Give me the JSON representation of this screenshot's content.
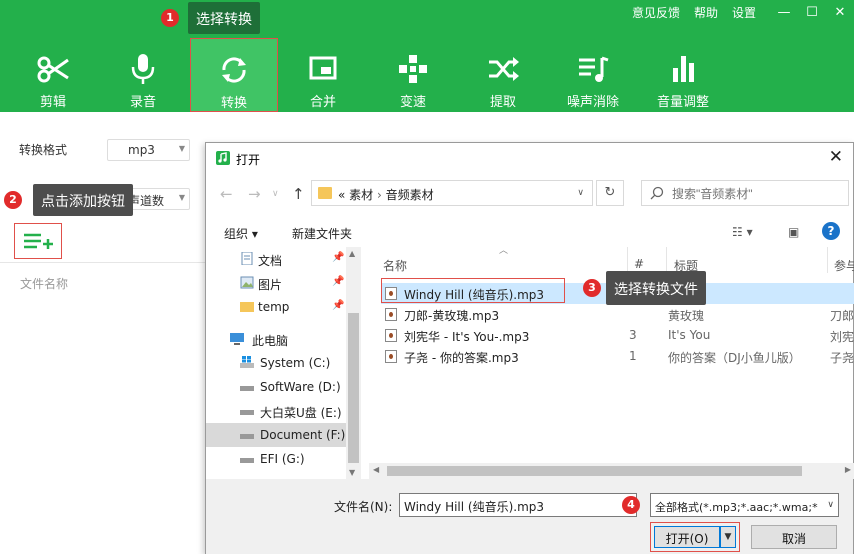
{
  "header": {
    "links": [
      "意见反馈",
      "帮助",
      "设置"
    ],
    "window_controls": [
      "—",
      "☐",
      "✕"
    ],
    "tools": [
      {
        "label": "剪辑",
        "icon": "scissors-icon"
      },
      {
        "label": "录音",
        "icon": "microphone-icon"
      },
      {
        "label": "转换",
        "icon": "sync-icon"
      },
      {
        "label": "合并",
        "icon": "merge-icon"
      },
      {
        "label": "变速",
        "icon": "speed-icon"
      },
      {
        "label": "提取",
        "icon": "shuffle-icon"
      },
      {
        "label": "噪声消除",
        "icon": "noise-icon"
      },
      {
        "label": "音量调整",
        "icon": "volume-bars-icon"
      }
    ],
    "active_tool": "转换"
  },
  "left_panel": {
    "format_label": "转换格式",
    "format_value": "mp3",
    "channel_value": "声道数",
    "file_name_column": "文件名称"
  },
  "dialog": {
    "title": "打开",
    "address": {
      "prefix": "«",
      "path": [
        "素材",
        "音频素材"
      ]
    },
    "search_placeholder": "搜索\"音频素材\"",
    "toolbar": {
      "organize": "组织 ▾",
      "new_folder": "新建文件夹"
    },
    "tree": [
      {
        "label": "文档",
        "icon": "document-icon",
        "pinned": true
      },
      {
        "label": "图片",
        "icon": "picture-icon",
        "pinned": true
      },
      {
        "label": "temp",
        "icon": "folder-icon",
        "pinned": true
      },
      {
        "label": "此电脑",
        "icon": "computer-icon",
        "pinned": false
      },
      {
        "label": "System (C:)",
        "icon": "windows-drive-icon",
        "pinned": false
      },
      {
        "label": "SoftWare (D:)",
        "icon": "drive-icon",
        "pinned": false
      },
      {
        "label": "大白菜U盘 (E:)",
        "icon": "drive-icon",
        "pinned": false
      },
      {
        "label": "Document (F:)",
        "icon": "drive-icon",
        "pinned": false
      },
      {
        "label": "EFI (G:)",
        "icon": "drive-icon",
        "pinned": false
      }
    ],
    "tree_selected": "Document (F:)",
    "columns": [
      "名称",
      "#",
      "标题",
      "参与"
    ],
    "files": [
      {
        "name": "Windy Hill (纯音乐).mp3",
        "num": "",
        "title": "",
        "artist": ""
      },
      {
        "name": "刀郎-黄玫瑰.mp3",
        "num": "",
        "title": "黄玫瑰",
        "artist": "刀郎"
      },
      {
        "name": "刘宪华 - It's You-.mp3",
        "num": "3",
        "title": "It's You",
        "artist": "刘宪"
      },
      {
        "name": "子尧 - 你的答案.mp3",
        "num": "1",
        "title": "你的答案（DJ小鱼儿版）",
        "artist": "子尧"
      }
    ],
    "filename_label": "文件名(N):",
    "filename_value": "Windy Hill (纯音乐).mp3",
    "filter_value": "全部格式(*.mp3;*.aac;*.wma;*",
    "open_label": "打开(O)",
    "cancel_label": "取消"
  },
  "annotations": [
    {
      "num": "1",
      "text": "选择转换"
    },
    {
      "num": "2",
      "text": "点击添加按钮"
    },
    {
      "num": "3",
      "text": "选择转换文件"
    },
    {
      "num": "4",
      "text": ""
    }
  ],
  "colors": {
    "brand": "#23b04b",
    "annotation": "#e12b2b",
    "selection": "#cce8ff"
  }
}
